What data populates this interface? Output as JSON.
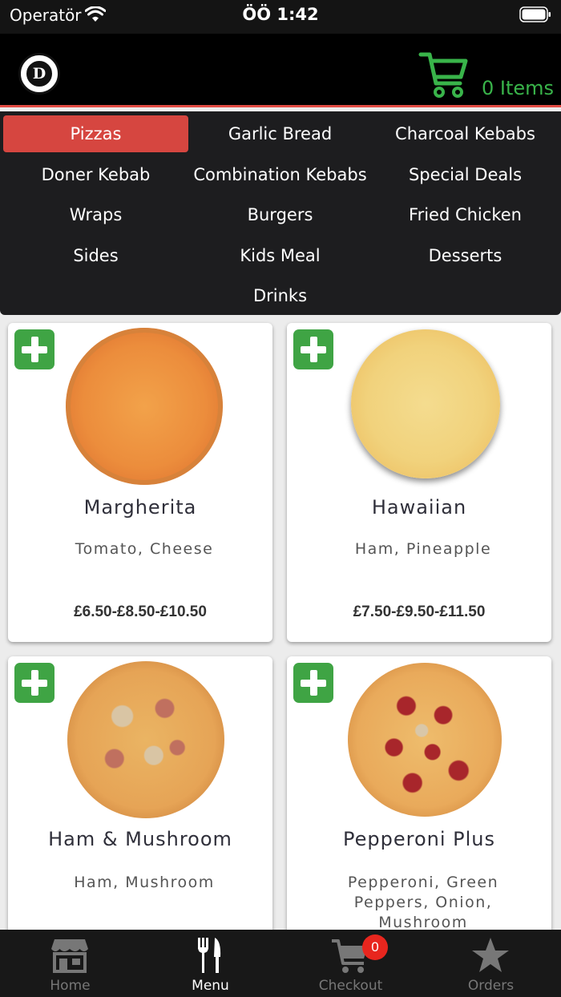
{
  "status_bar": {
    "carrier": "Operatör",
    "time": "ÖÖ 1:42"
  },
  "header": {
    "cart_label": "0 Items",
    "logo_letter": "D"
  },
  "categories": [
    "Pizzas",
    "Garlic Bread",
    "Charcoal Kebabs",
    "Doner Kebab",
    "Combination Kebabs",
    "Special Deals",
    "Wraps",
    "Burgers",
    "Fried Chicken",
    "Sides",
    "Kids Meal",
    "Desserts",
    "Drinks"
  ],
  "active_category": "Pizzas",
  "products": [
    {
      "name": "Margherita",
      "description": "Tomato, Cheese",
      "price": "£6.50-£8.50-£10.50"
    },
    {
      "name": "Hawaiian",
      "description": "Ham, Pineapple",
      "price": "£7.50-£9.50-£11.50"
    },
    {
      "name": "Ham & Mushroom",
      "description": "Ham, Mushroom",
      "price": ""
    },
    {
      "name": "Pepperoni Plus",
      "description": "Pepperoni, Green Peppers, Onion, Mushroom",
      "price": ""
    }
  ],
  "tabbar": {
    "tabs": [
      {
        "label": "Home",
        "icon": "store-icon"
      },
      {
        "label": "Menu",
        "icon": "fork-knife-icon"
      },
      {
        "label": "Checkout",
        "icon": "cart-icon"
      },
      {
        "label": "Orders",
        "icon": "star-icon"
      }
    ],
    "active": "Menu",
    "checkout_badge": "0"
  },
  "colors": {
    "accent_red": "#d64640",
    "cart_green": "#39b44a",
    "add_green": "#3fa444",
    "header_bg": "#000000",
    "category_bg": "#1d1d1f"
  }
}
